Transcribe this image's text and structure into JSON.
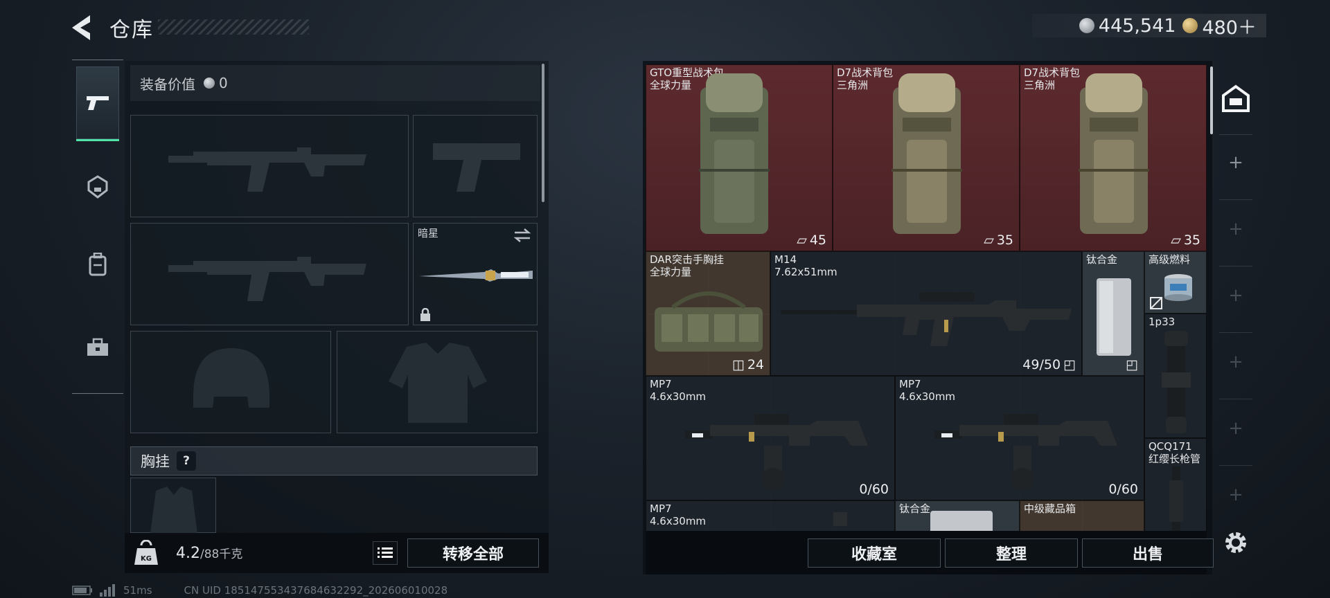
{
  "header": {
    "title": "仓库",
    "currency": [
      {
        "icon": "silver-coin-icon",
        "value": "445,541"
      },
      {
        "icon": "gold-coin-icon",
        "value": "480＋"
      }
    ]
  },
  "left_tabs": [
    {
      "icon": "pistol-icon",
      "active": true
    },
    {
      "icon": "helmet-icon",
      "active": false
    },
    {
      "icon": "backpack-icon",
      "active": false
    },
    {
      "icon": "toolbox-icon",
      "active": false
    }
  ],
  "equipment": {
    "value_label": "装备价值",
    "value": "0",
    "melee_label": "暗星",
    "chest_rig_label": "胸挂",
    "help": "?",
    "weight_current": "4.2",
    "weight_max": "/88千克",
    "kg_label": "KG",
    "transfer_all": "转移全部"
  },
  "storage_items": [
    {
      "name": "GTO重型战术包",
      "sub": "全球力量",
      "count": "45",
      "count_icon": "capacity-icon"
    },
    {
      "name": "D7战术背包",
      "sub": "三角洲",
      "count": "35",
      "count_icon": "capacity-icon"
    },
    {
      "name": "D7战术背包",
      "sub": "三角洲",
      "count": "35",
      "count_icon": "capacity-icon"
    },
    {
      "name": "DAR突击手胸挂",
      "sub": "全球力量",
      "count": "24",
      "count_icon": "vest-capacity-icon"
    },
    {
      "name": "M14",
      "sub": "7.62x51mm",
      "count": "49/50",
      "count_icon": "ammo-box-icon"
    },
    {
      "name": "钛合金",
      "sub": "",
      "count": "",
      "count_icon": "ammo-box-icon"
    },
    {
      "name": "高级燃料",
      "sub": "",
      "count": "",
      "count_icon": "ammo-box-icon"
    },
    {
      "name": "1p33",
      "sub": "",
      "count": ""
    },
    {
      "name": "MP7",
      "sub": "4.6x30mm",
      "count": "0/60"
    },
    {
      "name": "MP7",
      "sub": "4.6x30mm",
      "count": "0/60"
    },
    {
      "name": "QCQ171",
      "sub": "红缨长枪管",
      "count": ""
    },
    {
      "name": "MP7",
      "sub": "4.6x30mm",
      "count": ""
    },
    {
      "name": "钛合金",
      "sub": "",
      "count": ""
    },
    {
      "name": "中级藏品箱",
      "sub": "",
      "count": ""
    }
  ],
  "footer_buttons": {
    "collection": "收藏室",
    "organize": "整理",
    "sell": "出售"
  },
  "right_rail": {
    "top_icon": "warehouse-icon",
    "plus": "+",
    "settings_icon": "gear-icon"
  },
  "status": {
    "ping": "51ms",
    "uid": "CN UID 18514755343768463229​2_202606010028"
  },
  "colors": {
    "accent": "#4fe3a8",
    "rare_bg": "#5d2a2e"
  }
}
